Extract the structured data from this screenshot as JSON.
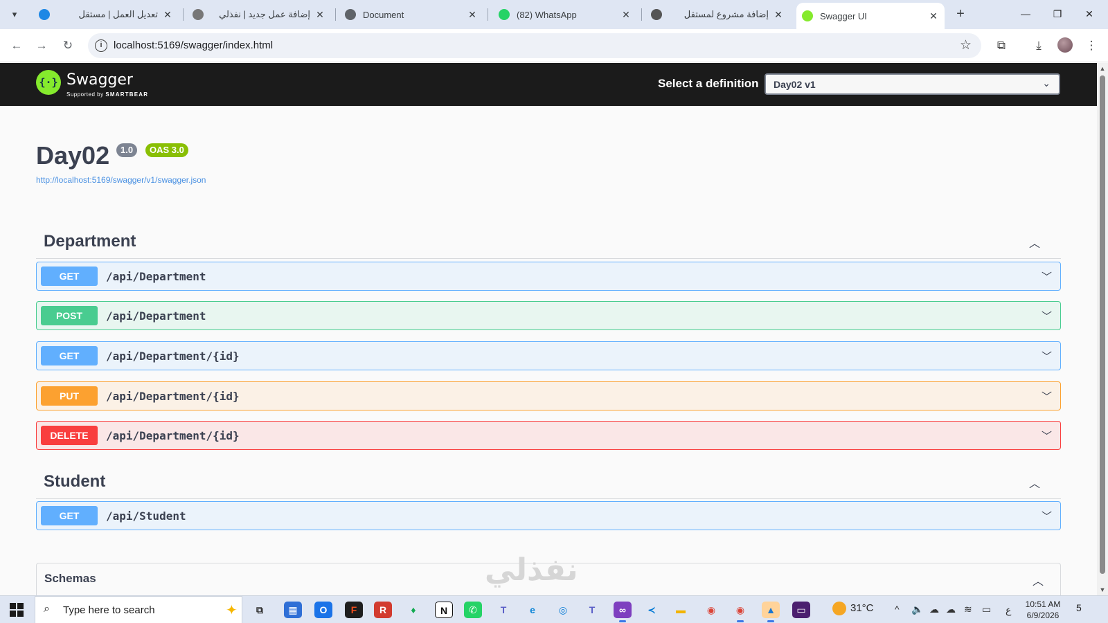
{
  "browser": {
    "tabs": [
      {
        "title": "تعديل العمل | مستقل",
        "rtl": true,
        "favicon_color": "#1e88e5"
      },
      {
        "title": "إضافة عمل جديد | نفذلي",
        "rtl": true,
        "favicon_color": "#666666"
      },
      {
        "title": "Document",
        "rtl": false,
        "favicon_color": "#5f6368"
      },
      {
        "title": "(82) WhatsApp",
        "rtl": false,
        "favicon_color": "#25d366"
      },
      {
        "title": "إضافة مشروع لمستقل",
        "rtl": true,
        "favicon_color": "#555555"
      },
      {
        "title": "Swagger UI",
        "rtl": false,
        "favicon_color": "#85ea2d"
      }
    ],
    "url": "localhost:5169/swagger/index.html"
  },
  "swagger": {
    "brand": "Swagger",
    "supported_by": "Supported by",
    "smartbear": "SMARTBEAR",
    "definition_label": "Select a definition",
    "definition_value": "Day02 v1"
  },
  "info": {
    "title": "Day02",
    "version": "1.0",
    "oas": "OAS 3.0",
    "spec_url": "http://localhost:5169/swagger/v1/swagger.json"
  },
  "tags": [
    {
      "name": "Department",
      "operations": [
        {
          "method": "GET",
          "path": "/api/Department"
        },
        {
          "method": "POST",
          "path": "/api/Department"
        },
        {
          "method": "GET",
          "path": "/api/Department/{id}"
        },
        {
          "method": "PUT",
          "path": "/api/Department/{id}"
        },
        {
          "method": "DELETE",
          "path": "/api/Department/{id}"
        }
      ]
    },
    {
      "name": "Student",
      "operations": [
        {
          "method": "GET",
          "path": "/api/Student"
        }
      ]
    }
  ],
  "schemas_label": "Schemas",
  "watermark": "نفذلي",
  "taskbar": {
    "search_placeholder": "Type here to search",
    "temperature": "31°C",
    "time": "10:51 AM",
    "date": "6/9/2026",
    "lang": "ع",
    "notifications": "5"
  },
  "colors": {
    "get": "#61affe",
    "post": "#49cc90",
    "put": "#fca130",
    "delete": "#f93e3e",
    "swagger_green": "#85ea2d",
    "topbar": "#1b1b1b"
  }
}
